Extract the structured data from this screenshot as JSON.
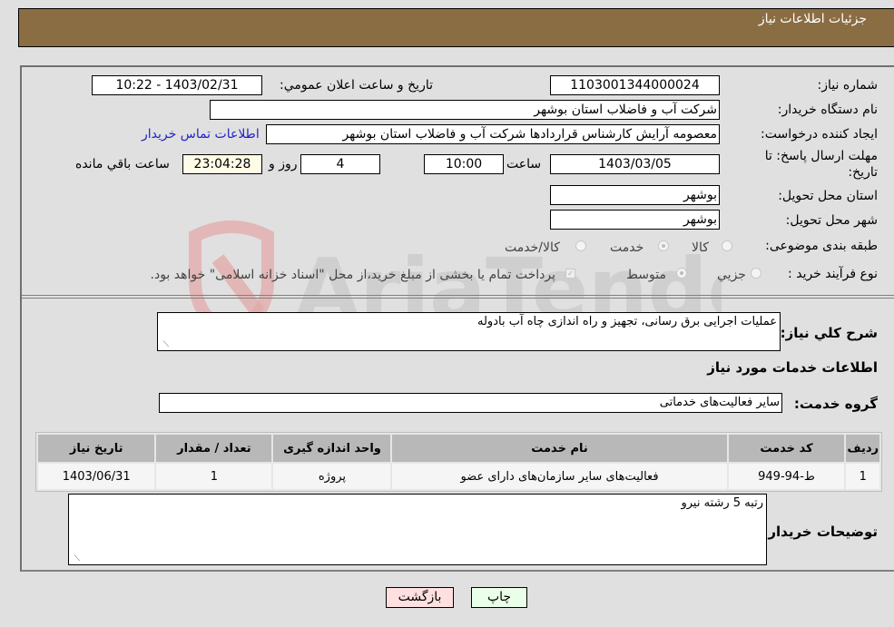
{
  "header": {
    "title": "جزئیات اطلاعات نیاز"
  },
  "form": {
    "need_number": {
      "label": "شماره نیاز:",
      "value": "1103001344000024"
    },
    "announce_datetime": {
      "label": "تاریخ و ساعت اعلان عمومي:",
      "value": "1403/02/31 - 10:22"
    },
    "buyer_org": {
      "label": "نام دستگاه خریدار:",
      "value": "شرکت آب و فاضلاب استان بوشهر"
    },
    "creator": {
      "label": "ایجاد کننده درخواست:",
      "value": "معصومه آرایش کارشناس قراردادها شرکت آب و فاضلاب استان بوشهر"
    },
    "contact_link": "اطلاعات تماس خریدار",
    "deadline": {
      "label_line1": "مهلت ارسال پاسخ: تا",
      "label_line2": "تاریخ:",
      "date": "1403/03/05",
      "time_label": "ساعت",
      "time": "10:00",
      "days": "4",
      "days_label": "روز و",
      "remaining": "23:04:28",
      "remaining_label": "ساعت باقي مانده"
    },
    "province": {
      "label": "استان محل تحویل:",
      "value": "بوشهر"
    },
    "city": {
      "label": "شهر محل تحویل:",
      "value": "بوشهر"
    },
    "category": {
      "label": "طبقه بندی موضوعی:",
      "options": [
        "کالا",
        "خدمت",
        "کالا/خدمت"
      ],
      "selected": "خدمت"
    },
    "purchase_type": {
      "label": "نوع فرآیند خرید :",
      "options": [
        "جزيي",
        "متوسط"
      ],
      "selected": "متوسط",
      "treasury_note": "پرداخت تمام یا بخشی از مبلغ خرید،از محل \"اسناد خزانه اسلامی\" خواهد بود."
    }
  },
  "description": {
    "label": "شرح کلي نیاز:",
    "value": "عملیات اجرایی برق رسانی، تجهیز و راه اندازی چاه آب بادوله"
  },
  "services_section_title": "اطلاعات خدمات مورد نیاز",
  "service_group": {
    "label": "گروه خدمت:",
    "value": "سایر فعالیت‌های خدماتی"
  },
  "table": {
    "headers": [
      "ردیف",
      "کد خدمت",
      "نام خدمت",
      "واحد اندازه گیری",
      "تعداد / مقدار",
      "تاریخ نیاز"
    ],
    "rows": [
      [
        "1",
        "ط-94-949",
        "فعالیت‌های سایر سازمان‌های دارای عضو",
        "پروژه",
        "1",
        "1403/06/31"
      ]
    ]
  },
  "buyer_notes": {
    "label": "توضیحات خریدار:",
    "value": "رتبه 5 رشته نیرو"
  },
  "buttons": {
    "print": "چاپ",
    "back": "بازگشت"
  },
  "watermark": "AriaTender.neT"
}
